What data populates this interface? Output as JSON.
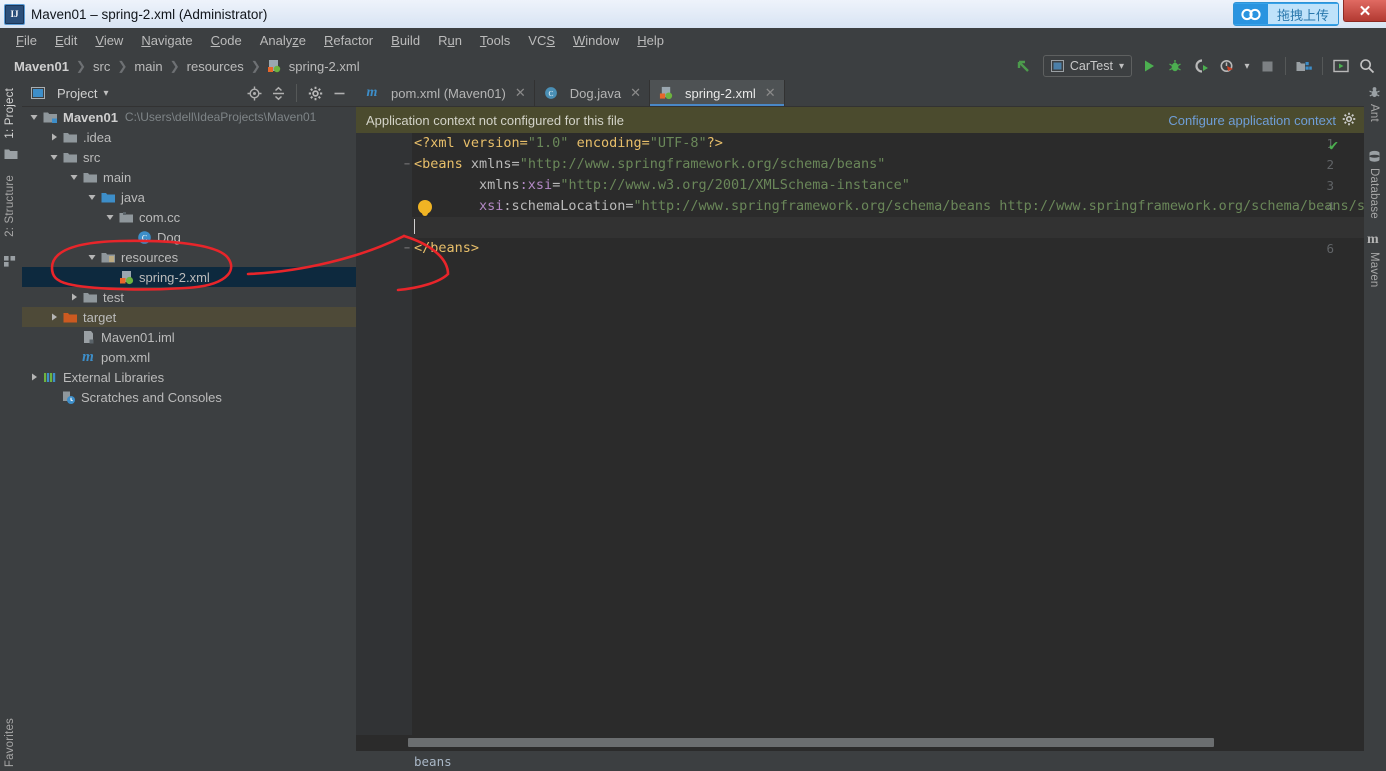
{
  "window": {
    "title": "Maven01 – spring-2.xml (Administrator)",
    "app_icon": "intellij-idea-icon",
    "close_label": "✕",
    "baidu_upload": {
      "icon": "baidu-netdisk-icon",
      "label": "拖拽上传"
    }
  },
  "menubar": {
    "items": [
      {
        "label": "File",
        "mnemonic": "F"
      },
      {
        "label": "Edit",
        "mnemonic": "E"
      },
      {
        "label": "View",
        "mnemonic": "V"
      },
      {
        "label": "Navigate",
        "mnemonic": "N"
      },
      {
        "label": "Code",
        "mnemonic": "C"
      },
      {
        "label": "Analyze",
        "mnemonic": "z"
      },
      {
        "label": "Refactor",
        "mnemonic": "R"
      },
      {
        "label": "Build",
        "mnemonic": "B"
      },
      {
        "label": "Run",
        "mnemonic": "u"
      },
      {
        "label": "Tools",
        "mnemonic": "T"
      },
      {
        "label": "VCS",
        "mnemonic": "S"
      },
      {
        "label": "Window",
        "mnemonic": "W"
      },
      {
        "label": "Help",
        "mnemonic": "H"
      }
    ]
  },
  "navbar": {
    "breadcrumbs": [
      "Maven01",
      "src",
      "main",
      "resources",
      "spring-2.xml"
    ],
    "separator": "❯"
  },
  "toolbar": {
    "back_icon": "back-arrow-icon",
    "run_config": {
      "label": "CarTest",
      "icon": "run-config-icon",
      "caret": "▾"
    },
    "buttons": [
      {
        "name": "run-button",
        "icon": "run-triangle-icon"
      },
      {
        "name": "debug-button",
        "icon": "debug-bug-icon"
      },
      {
        "name": "run-with-coverage-button",
        "icon": "coverage-icon"
      },
      {
        "name": "profiler-button",
        "icon": "profiler-clock-icon"
      },
      {
        "name": "stop-button",
        "icon": "stop-square-icon"
      },
      {
        "name": "project-structure-button",
        "icon": "project-structure-icon"
      },
      {
        "name": "ide-settings-button",
        "icon": "ide-window-icon"
      },
      {
        "name": "search-everywhere-button",
        "icon": "search-icon"
      }
    ]
  },
  "left_strip": {
    "tabs": [
      {
        "label": "1: Project",
        "selected": true,
        "icon": "project-icon"
      },
      {
        "label": "2: Structure",
        "selected": false,
        "icon": "structure-icon"
      },
      {
        "label": "Favorites",
        "selected": false,
        "icon": "favorites-icon"
      }
    ]
  },
  "right_strip": {
    "tabs": [
      {
        "label": "Ant",
        "icon": "ant-icon"
      },
      {
        "label": "Database",
        "icon": "database-icon"
      },
      {
        "label": "Maven",
        "icon": "maven-icon"
      }
    ]
  },
  "project_panel": {
    "title": "Project",
    "caret": "▾",
    "view_icon": "project-view-icon",
    "tools": [
      {
        "name": "scroll-from-source-button",
        "icon": "target-icon"
      },
      {
        "name": "collapse-all-button",
        "icon": "collapse-all-icon"
      },
      {
        "name": "settings-button",
        "icon": "gear-icon"
      },
      {
        "name": "hide-button",
        "icon": "minimize-icon"
      }
    ],
    "tree": [
      {
        "label": "Maven01",
        "sub": "C:\\Users\\dell\\IdeaProjects\\Maven01",
        "depth": 0,
        "arrow": "down",
        "icon": "module-icon",
        "bold": true,
        "state": "none"
      },
      {
        "label": ".idea",
        "sub": "",
        "depth": 1,
        "arrow": "right",
        "icon": "folder-icon",
        "bold": false,
        "state": "none"
      },
      {
        "label": "src",
        "sub": "",
        "depth": 1,
        "arrow": "down",
        "icon": "folder-icon",
        "bold": false,
        "state": "none"
      },
      {
        "label": "main",
        "sub": "",
        "depth": 2,
        "arrow": "down",
        "icon": "folder-icon",
        "bold": false,
        "state": "none"
      },
      {
        "label": "java",
        "sub": "",
        "depth": 3,
        "arrow": "down",
        "icon": "source-folder-icon",
        "bold": false,
        "state": "none"
      },
      {
        "label": "com.cc",
        "sub": "",
        "depth": 4,
        "arrow": "down",
        "icon": "package-icon",
        "bold": false,
        "state": "none"
      },
      {
        "label": "Dog",
        "sub": "",
        "depth": 5,
        "arrow": "none",
        "icon": "java-class-icon",
        "bold": false,
        "state": "none"
      },
      {
        "label": "resources",
        "sub": "",
        "depth": 3,
        "arrow": "down",
        "icon": "resource-folder-icon",
        "bold": false,
        "state": "none"
      },
      {
        "label": "spring-2.xml",
        "sub": "",
        "depth": 4,
        "arrow": "none",
        "icon": "spring-xml-icon",
        "bold": false,
        "state": "selected"
      },
      {
        "label": "test",
        "sub": "",
        "depth": 2,
        "arrow": "right",
        "icon": "folder-icon",
        "bold": false,
        "state": "none"
      },
      {
        "label": "target",
        "sub": "",
        "depth": 1,
        "arrow": "right",
        "icon": "excluded-folder-icon",
        "bold": false,
        "state": "highlight"
      },
      {
        "label": "Maven01.iml",
        "sub": "",
        "depth": 1,
        "arrow": "none",
        "icon": "iml-file-icon",
        "bold": false,
        "state": "none"
      },
      {
        "label": "pom.xml",
        "sub": "",
        "depth": 1,
        "arrow": "none",
        "icon": "maven-pom-icon",
        "bold": false,
        "state": "none"
      },
      {
        "label": "External Libraries",
        "sub": "",
        "depth": 0,
        "arrow": "right",
        "icon": "libraries-icon",
        "bold": false,
        "state": "none"
      },
      {
        "label": "Scratches and Consoles",
        "sub": "",
        "depth": 0,
        "arrow": "none",
        "icon": "scratches-icon",
        "bold": false,
        "state": "none"
      }
    ]
  },
  "editor": {
    "tabs": [
      {
        "label": "pom.xml (Maven01)",
        "icon": "maven-pom-icon",
        "active": false,
        "close": "✕"
      },
      {
        "label": "Dog.java",
        "icon": "java-class-icon",
        "active": false,
        "close": "✕"
      },
      {
        "label": "spring-2.xml",
        "icon": "spring-xml-icon",
        "active": true,
        "close": "✕"
      }
    ],
    "notification": {
      "message": "Application context not configured for this file",
      "action_label": "Configure application context",
      "action_icon": "gear-icon"
    },
    "inspection_status": "✔",
    "breadcrumb": "beans",
    "gutter_bulb_line": 4,
    "caret_line": 5,
    "lines": [
      {
        "num": 1,
        "fold": "",
        "tokens": [
          {
            "t": "<?xml version=",
            "c": "k-pi"
          },
          {
            "t": "\"1.0\"",
            "c": "k-val"
          },
          {
            "t": " encoding=",
            "c": "k-pi"
          },
          {
            "t": "\"UTF-8\"",
            "c": "k-val"
          },
          {
            "t": "?>",
            "c": "k-pi"
          }
        ]
      },
      {
        "num": 2,
        "fold": "−",
        "tokens": [
          {
            "t": "<beans",
            "c": "k-tag"
          },
          {
            "t": " xmlns=",
            "c": "k-attr"
          },
          {
            "t": "\"http://www.springframework.org/schema/beans\"",
            "c": "k-val"
          }
        ]
      },
      {
        "num": 3,
        "fold": "",
        "tokens": [
          {
            "t": "        xmlns",
            "c": "k-attr"
          },
          {
            "t": ":xsi",
            "c": "k-ns"
          },
          {
            "t": "=",
            "c": "k-attr"
          },
          {
            "t": "\"http://www.w3.org/2001/XMLSchema-instance\"",
            "c": "k-val"
          }
        ]
      },
      {
        "num": 4,
        "fold": "",
        "tokens": [
          {
            "t": "        xsi",
            "c": "k-ns"
          },
          {
            "t": ":schemaLocation=",
            "c": "k-attr"
          },
          {
            "t": "\"http://www.springframework.org/schema/beans http://www.springframework.org/schema/beans/spri",
            "c": "k-val"
          }
        ]
      },
      {
        "num": 5,
        "fold": "",
        "tokens": []
      },
      {
        "num": 6,
        "fold": "−",
        "tokens": [
          {
            "t": "</beans>",
            "c": "k-tag"
          }
        ]
      }
    ]
  },
  "annotations": {
    "ellipse_label": "red-ellipse-around-spring-xml",
    "arrow_label": "red-arrow-to-editor",
    "color": "#e8252a"
  },
  "colors": {
    "bg": "#3c3f41",
    "editor_bg": "#2b2b2b",
    "gutter_bg": "#313335",
    "selection": "#0d293e",
    "notification": "#4b4b2e",
    "accent_link": "#6f9ed8",
    "tab_active": "#4e5254",
    "tab_underline": "#4a88c7",
    "annotation_red": "#e8252a"
  }
}
